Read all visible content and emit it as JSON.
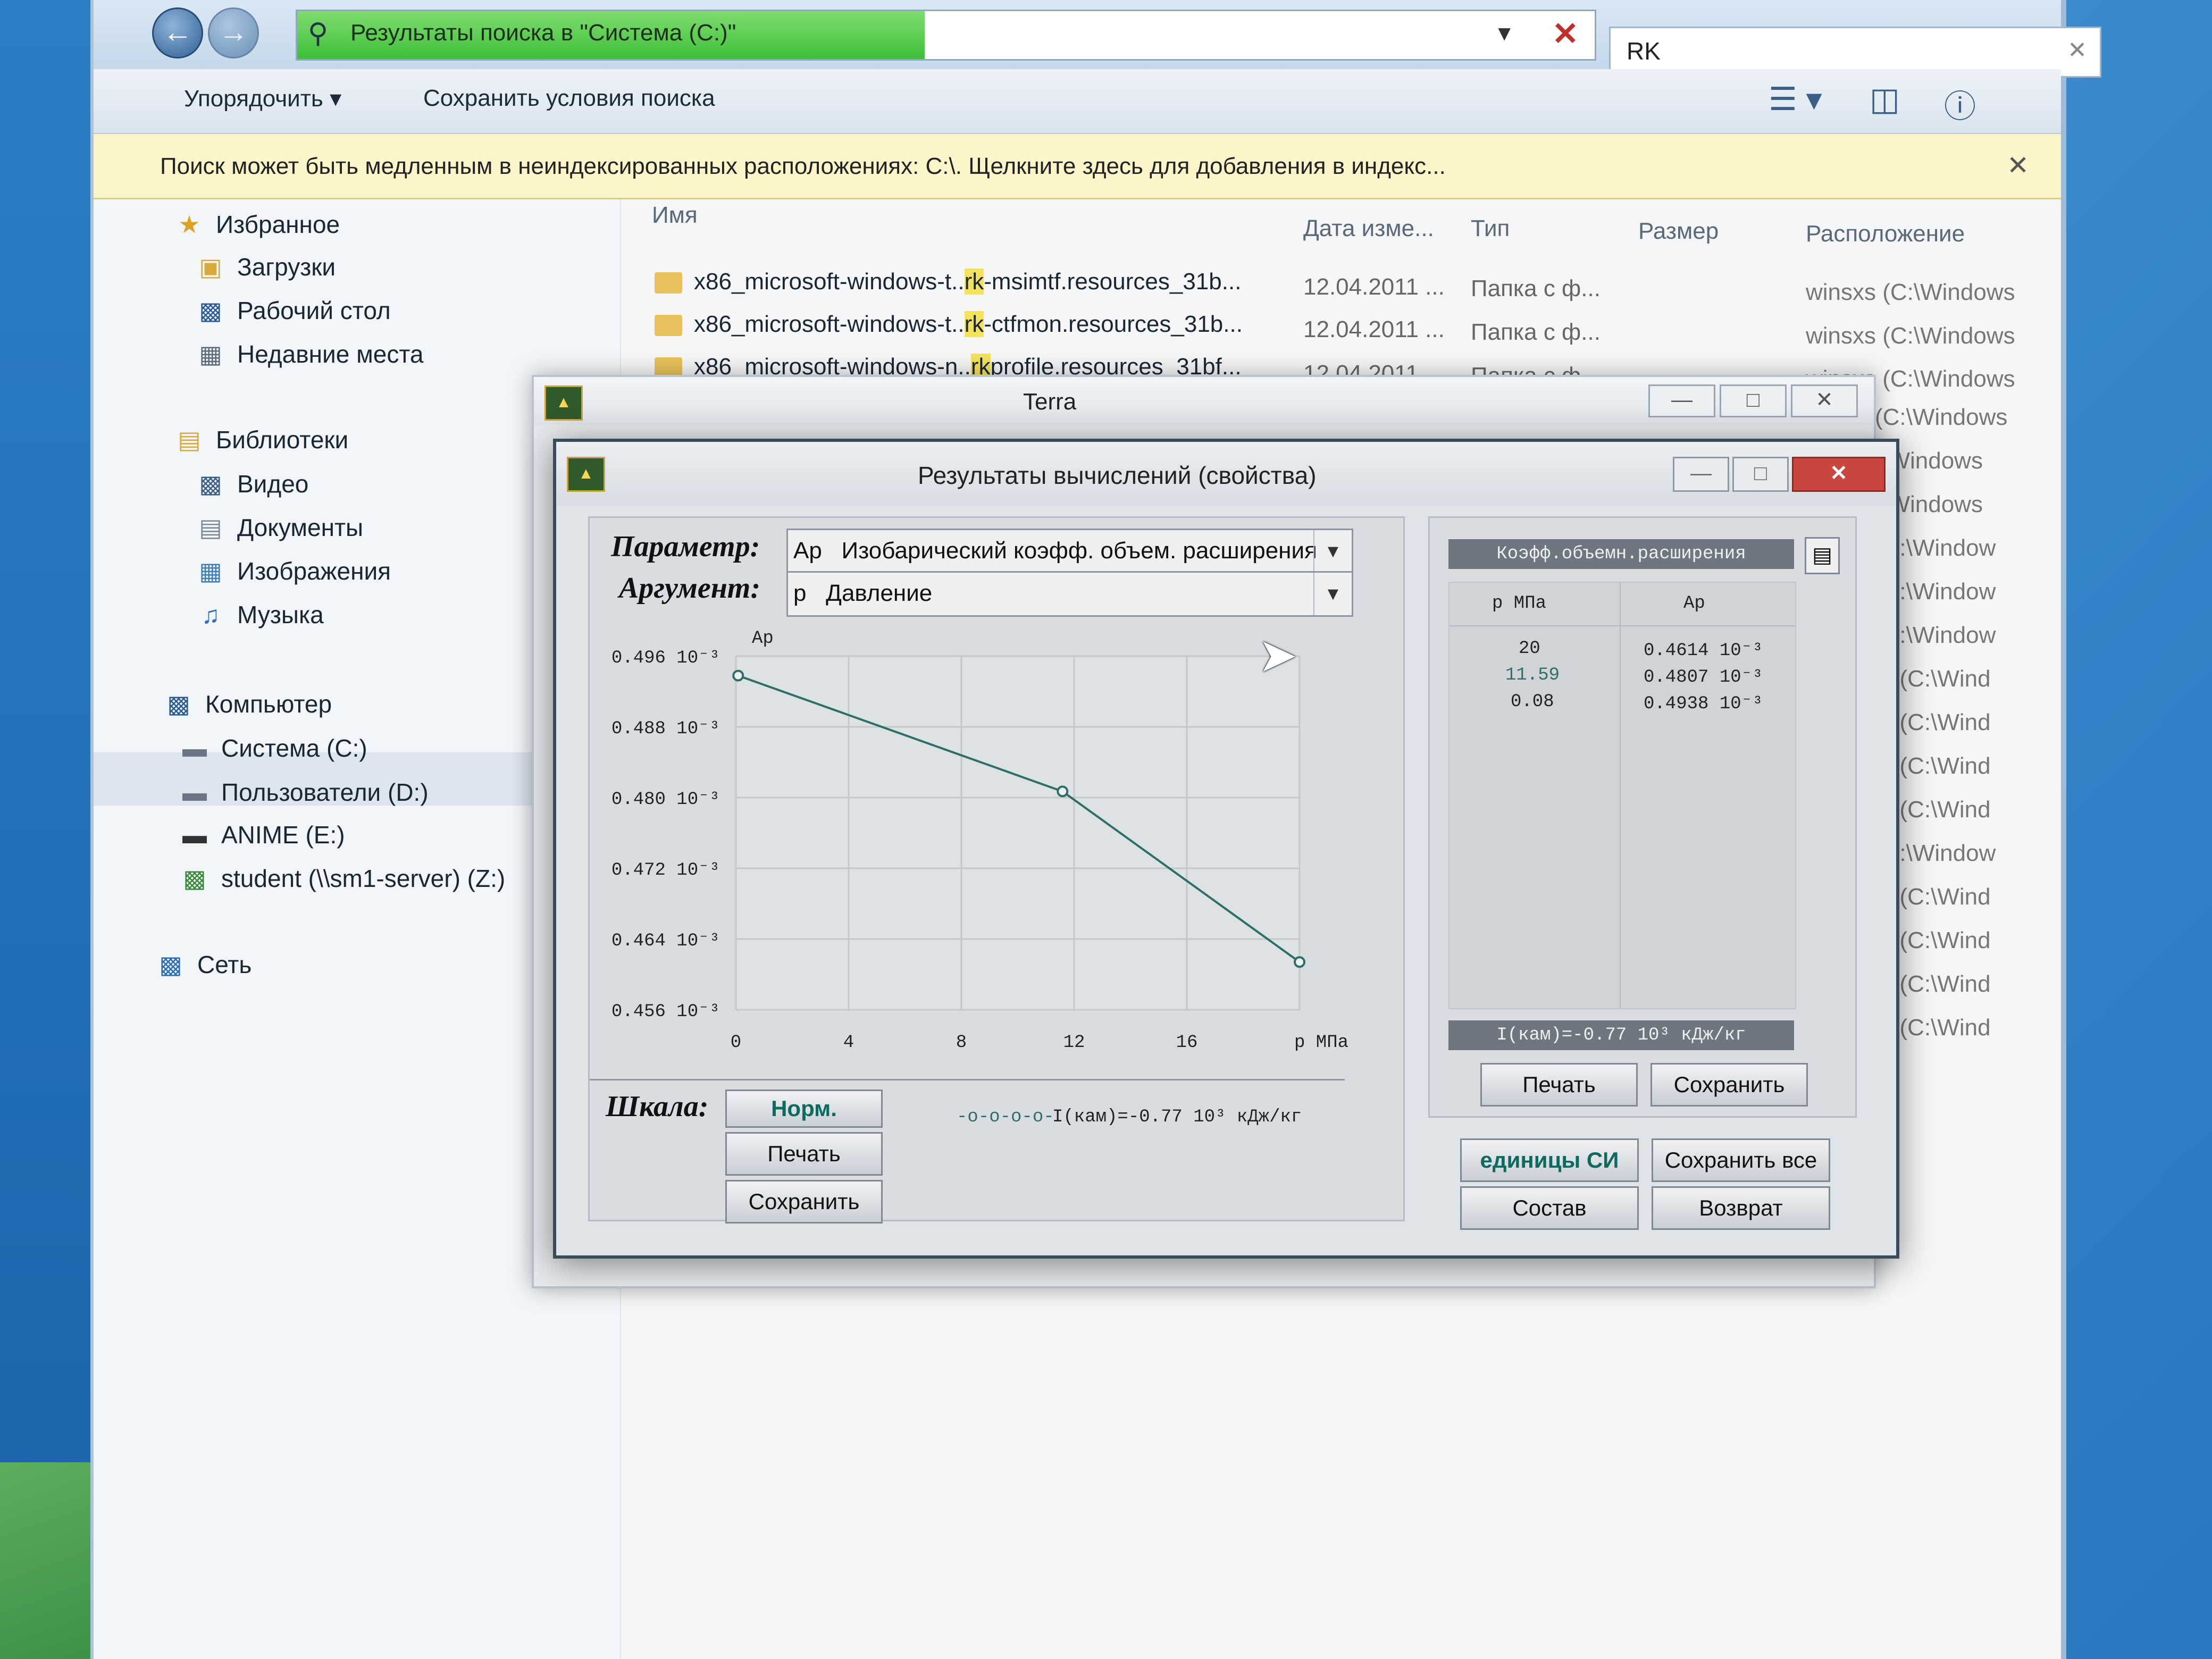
{
  "explorer": {
    "address": "Результаты поиска в \"Система (C:)\"",
    "search_value": "RK",
    "toolbar": {
      "organize": "Упорядочить",
      "save_search": "Сохранить условия поиска"
    },
    "infobar": "Поиск может быть медленным в неиндексированных расположениях: C:\\. Щелкните здесь для добавления в индекс...",
    "nav": {
      "favorites": "Избранное",
      "downloads": "Загрузки",
      "desktop": "Рабочий стол",
      "recent": "Недавние места",
      "libraries": "Библиотеки",
      "video": "Видео",
      "documents": "Документы",
      "images": "Изображения",
      "music": "Музыка",
      "computer": "Компьютер",
      "drive_c": "Система (C:)",
      "drive_d": "Пользователи (D:)",
      "drive_e": "ANIME (E:)",
      "drive_z": "student (\\\\sm1-server) (Z:)",
      "network": "Сеть"
    },
    "columns": {
      "name": "Имя",
      "date": "Дата изме...",
      "type": "Тип",
      "size": "Размер",
      "location": "Расположение"
    },
    "rows": [
      {
        "pre": "x86_microsoft-windows-t..",
        "hl": "rk",
        "post": "-msimtf.resources_31b...",
        "date": "12.04.2011 ...",
        "type": "Папка с ф...",
        "loc": "winsxs (C:\\Windows"
      },
      {
        "pre": "x86_microsoft-windows-t..",
        "hl": "rk",
        "post": "-ctfmon.resources_31b...",
        "date": "12.04.2011 ...",
        "type": "Папка с ф...",
        "loc": "winsxs (C:\\Windows"
      },
      {
        "pre": "x86_microsoft-windows-n..",
        "hl": "rk",
        "post": "profile.resources_31bf...",
        "date": "12.04.2011 ...",
        "type": "Папка с ф...",
        "loc": "winsxs (C:\\Windows"
      }
    ],
    "right_locs": [
      "(C:\\Windows",
      ":\\Windows",
      ":\\Windows",
      "(C:\\Window",
      "(C:\\Window",
      "(C:\\Window",
      "ts (C:\\Wind",
      "ts (C:\\Wind",
      "ts (C:\\Wind",
      "ts (C:\\Wind",
      "(C:\\Window",
      "ts (C:\\Wind",
      "ts (C:\\Wind",
      "ts (C:\\Wind",
      "ts (C:\\Wind"
    ]
  },
  "terra": {
    "title": "Terra",
    "icon": "terra-app-icon"
  },
  "dialog": {
    "title": "Результаты вычислений (свойства)",
    "param_label": "Параметр:",
    "param_value": "Ap   Изобарический коэфф. объем. расширения",
    "arg_label": "Аргумент:",
    "arg_value": "p   Давление",
    "scale_label": "Шкала:",
    "btn_norm": "Норм.",
    "btn_print": "Печать",
    "btn_save": "Сохранить",
    "legend": "I(кам)=-0.77 10³  кДж/кг",
    "table_title": "Коэфф.объемн.расширения",
    "table_col1": "p  МПа",
    "table_col2": "Ap",
    "table_rows": [
      {
        "p": "20",
        "ap": "0.4614 10⁻³"
      },
      {
        "p": "11.59",
        "ap": "0.4807 10⁻³"
      },
      {
        "p": "0.08",
        "ap": "0.4938 10⁻³"
      }
    ],
    "table_status": "I(кам)=-0.77 10³  кДж/кг",
    "table_print": "Печать",
    "table_save": "Сохранить",
    "btn_si": "единицы СИ",
    "btn_save_all": "Сохранить все",
    "btn_compose": "Состав",
    "btn_return": "Возврат"
  },
  "chart_data": {
    "type": "line",
    "ylabel": "Ap",
    "xlabel": "p  МПа",
    "x_ticks": [
      "0",
      "4",
      "8",
      "12",
      "16"
    ],
    "y_ticks": [
      "0.496 10⁻³",
      "0.488 10⁻³",
      "0.480 10⁻³",
      "0.472 10⁻³",
      "0.464 10⁻³",
      "0.456 10⁻³"
    ],
    "xlim": [
      0,
      20
    ],
    "ylim": [
      0.456,
      0.496
    ],
    "series": [
      {
        "name": "I(кам)=-0.77 10³  кДж/кг",
        "x": [
          0.08,
          11.59,
          20
        ],
        "y": [
          0.4938,
          0.4807,
          0.4614
        ]
      }
    ],
    "grid": true,
    "colors": {
      "line": "#2f6e66",
      "plot_bg": "#dde2e4",
      "grid": "#c2c8cc"
    }
  }
}
